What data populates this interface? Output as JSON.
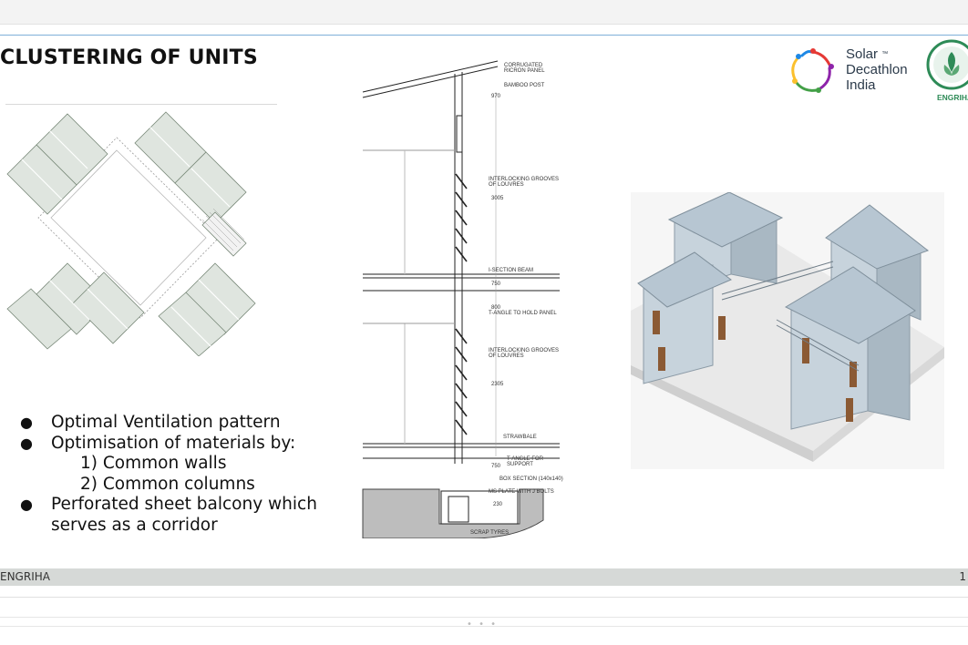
{
  "slide": {
    "title": "CLUSTERING OF UNITS",
    "bullets": [
      "Optimal Ventilation pattern",
      "Optimisation of materials by:",
      "1) Common walls",
      "2) Common columns",
      "Perforated sheet balcony which",
      "serves as a corridor"
    ],
    "bullet_marker": "●",
    "footer_left": "ENGRIHA",
    "footer_right": "1"
  },
  "logos": {
    "solar_line1": "Solar",
    "solar_tm": "™",
    "solar_line2": "Decathlon",
    "solar_line3": "India",
    "engriha": "ENGRIHA"
  },
  "section_labels": {
    "l1": "CORRUGATED",
    "l1b": "RICRON PANEL",
    "l2": "BAMBOO POST",
    "l3": "INTERLOCKING GROOVES",
    "l3b": "OF LOUVRES",
    "l4": "I-SECTION BEAM",
    "l5": "T-ANGLE TO HOLD PANEL",
    "l6": "INTERLOCKING GROOVES",
    "l6b": "OF LOUVRES",
    "l7": "STRAWBALE",
    "l8": "T-ANGLE FOR",
    "l8b": "SUPPORT",
    "l9": "BOX SECTION (140x140)",
    "l10": "MS PLATE WITH J BOLTS",
    "l11": "SCRAP TYRES",
    "d1": "970",
    "d2": "3005",
    "d3": "750",
    "d4": "800",
    "d5": "2305",
    "d6": "750",
    "d7": "230"
  },
  "ui": {
    "window_handle": "• • •"
  }
}
